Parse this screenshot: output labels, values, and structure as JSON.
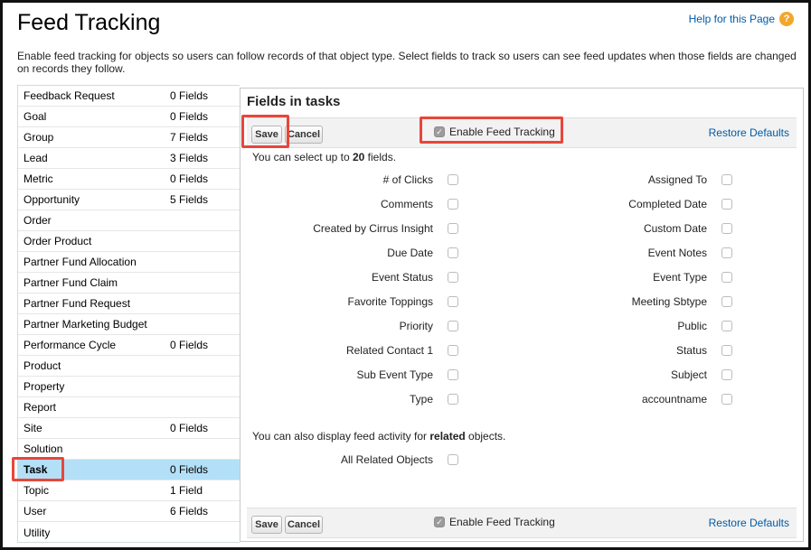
{
  "page": {
    "title": "Feed Tracking",
    "help_link": "Help for this Page",
    "help_icon": "?",
    "intro": "Enable feed tracking for objects so users can follow records of that object type. Select fields to track so users can see feed updates when those fields are changed on records they follow."
  },
  "objects": [
    {
      "name": "Feedback Request",
      "count": "0 Fields"
    },
    {
      "name": "Goal",
      "count": "0 Fields"
    },
    {
      "name": "Group",
      "count": "7 Fields"
    },
    {
      "name": "Lead",
      "count": "3 Fields"
    },
    {
      "name": "Metric",
      "count": "0 Fields"
    },
    {
      "name": "Opportunity",
      "count": "5 Fields"
    },
    {
      "name": "Order",
      "count": ""
    },
    {
      "name": "Order Product",
      "count": ""
    },
    {
      "name": "Partner Fund Allocation",
      "count": ""
    },
    {
      "name": "Partner Fund Claim",
      "count": ""
    },
    {
      "name": "Partner Fund Request",
      "count": ""
    },
    {
      "name": "Partner Marketing Budget",
      "count": ""
    },
    {
      "name": "Performance Cycle",
      "count": "0 Fields"
    },
    {
      "name": "Product",
      "count": ""
    },
    {
      "name": "Property",
      "count": ""
    },
    {
      "name": "Report",
      "count": ""
    },
    {
      "name": "Site",
      "count": "0 Fields"
    },
    {
      "name": "Solution",
      "count": ""
    },
    {
      "name": "Task",
      "count": "0 Fields",
      "selected": true
    },
    {
      "name": "Topic",
      "count": "1 Field"
    },
    {
      "name": "User",
      "count": "6 Fields"
    },
    {
      "name": "Utility",
      "count": ""
    }
  ],
  "panel": {
    "title": "Fields in tasks",
    "save_label": "Save",
    "cancel_label": "Cancel",
    "enable_label": "Enable Feed Tracking",
    "enable_checked": true,
    "restore_label": "Restore Defaults",
    "limit_prefix": "You can select up to ",
    "limit_number": "20",
    "limit_suffix": " fields.",
    "related_prefix": "You can also display feed activity for ",
    "related_bold": "related",
    "related_suffix": " objects.",
    "all_related_label": "All Related Objects"
  },
  "fields_left": [
    "# of Clicks",
    "Comments",
    "Created by Cirrus Insight",
    "Due Date",
    "Event Status",
    "Favorite Toppings",
    "Priority",
    "Related Contact 1",
    "Sub Event Type",
    "Type"
  ],
  "fields_right": [
    "Assigned To",
    "Completed Date",
    "Custom Date",
    "Event Notes",
    "Event Type",
    "Meeting Sbtype",
    "Public",
    "Status",
    "Subject",
    "accountname"
  ],
  "colors": {
    "selected_row": "#b3e0f7",
    "highlight": "#e8463a",
    "link": "#015ba7",
    "help_icon": "#f2a72b"
  }
}
